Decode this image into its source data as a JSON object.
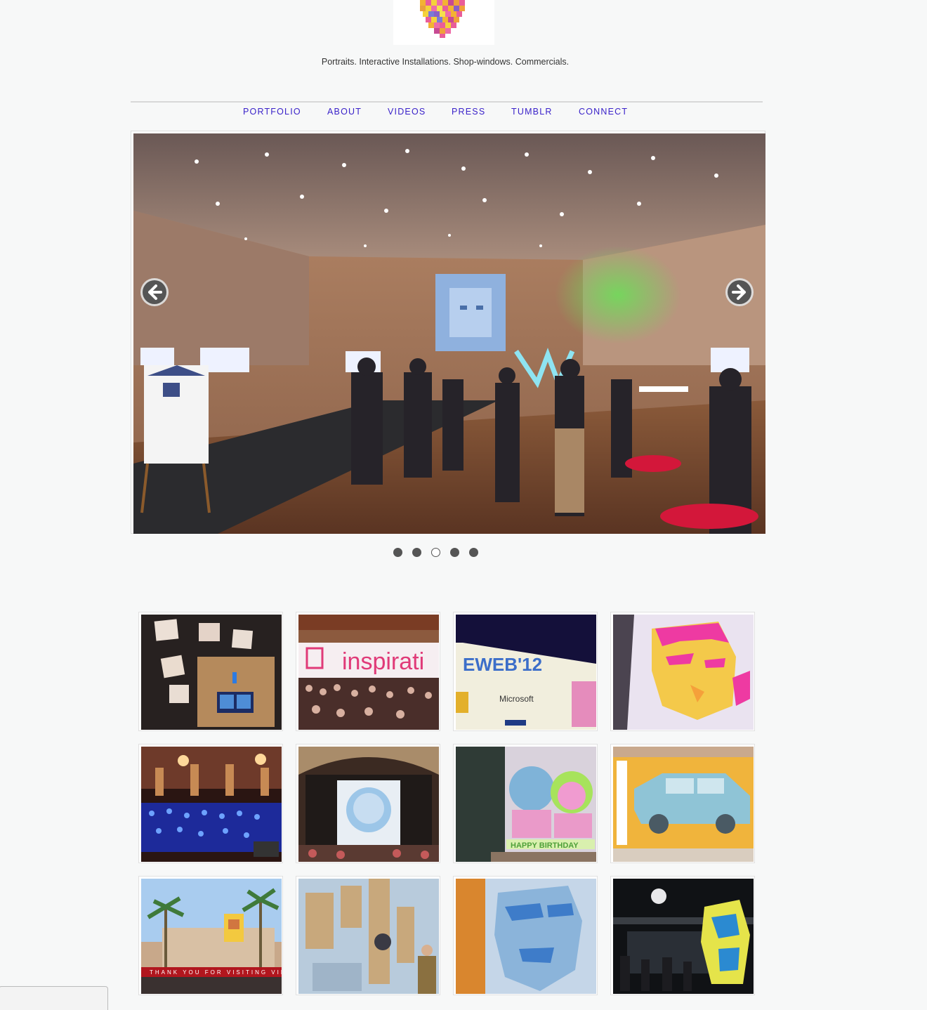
{
  "header": {
    "logo_icon": "pixel-portrait-logo",
    "tagline": "Portraits. Interactive Installations. Shop-windows. Commercials."
  },
  "nav": {
    "items": [
      {
        "label": "PORTFOLIO"
      },
      {
        "label": "ABOUT"
      },
      {
        "label": "VIDEOS"
      },
      {
        "label": "PRESS"
      },
      {
        "label": "TUMBLR"
      },
      {
        "label": "CONNECT"
      }
    ],
    "link_color": "#3a22c9"
  },
  "slider": {
    "prev_icon": "arrow-left-icon",
    "next_icon": "arrow-right-icon",
    "slide_count": 5,
    "active_slide": 3
  },
  "gallery": {
    "thumbnail_count": 12
  },
  "colors": {
    "background": "#f7f8f8",
    "accent": "#3a22c9"
  }
}
